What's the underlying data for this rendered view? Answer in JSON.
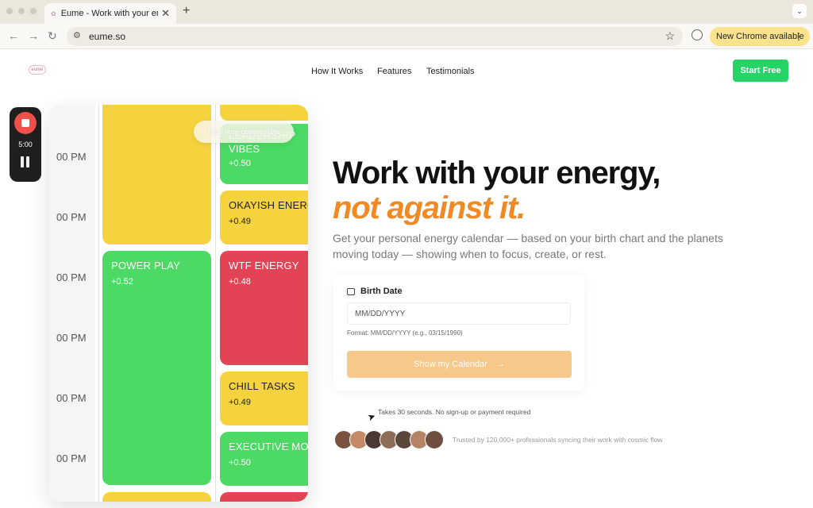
{
  "browser": {
    "tab_title": "Eume - Work with your energ",
    "tab_close": "✕",
    "new_tab": "+",
    "url": "eume.so",
    "update_label": "New Chrome available",
    "update_more": "⋮"
  },
  "header": {
    "logo_text": "eume",
    "nav": [
      "How It Works",
      "Features",
      "Testimonials"
    ],
    "cta": "Start Free"
  },
  "recorder": {
    "time": "5:00"
  },
  "calendar": {
    "times": [
      "00 PM",
      "00 PM",
      "00 PM",
      "00 PM",
      "00 PM",
      "00 PM"
    ],
    "badge": "Real-time cosmic data",
    "blocks": [
      {
        "title": "",
        "score": "",
        "color": "yellow"
      },
      {
        "title": "POWER PLAY",
        "score": "+0.52",
        "color": "green"
      },
      {
        "title": "LEADERSHIP VIBES",
        "title_line1": "LEADERSHIP",
        "title_line2": "VIBES",
        "score": "+0.50",
        "color": "green"
      },
      {
        "title": "OKAYISH ENERGY",
        "score": "+0.49",
        "color": "yellow"
      },
      {
        "title": "WTF ENERGY",
        "score": "+0.48",
        "color": "red"
      },
      {
        "title": "CHILL TASKS",
        "score": "+0.49",
        "color": "yellow"
      },
      {
        "title": "EXECUTIVE MOMENT",
        "score": "+0.50",
        "color": "green"
      }
    ]
  },
  "hero": {
    "headline_main": "Work with your energy,",
    "headline_accent": "not against it.",
    "subhead": "Get your personal energy calendar — based on your birth chart and the planets moving today — showing when to focus, create, or rest."
  },
  "form": {
    "label": "Birth Date",
    "placeholder": "MM/DD/YYYY",
    "hint": "Format: MM/DD/YYYY (e.g., 03/15/1990)",
    "button": "Show my Calendar",
    "button_arrow": "→"
  },
  "note": "Takes 30 seconds. No sign-up or payment required",
  "trust": "Trusted by 120,000+ professionals syncing their work with cosmic flow",
  "colors": {
    "accent": "#f08a24",
    "cta": "#25d366",
    "green": "#4cd964",
    "yellow": "#f5d33f",
    "red": "#e24455"
  }
}
